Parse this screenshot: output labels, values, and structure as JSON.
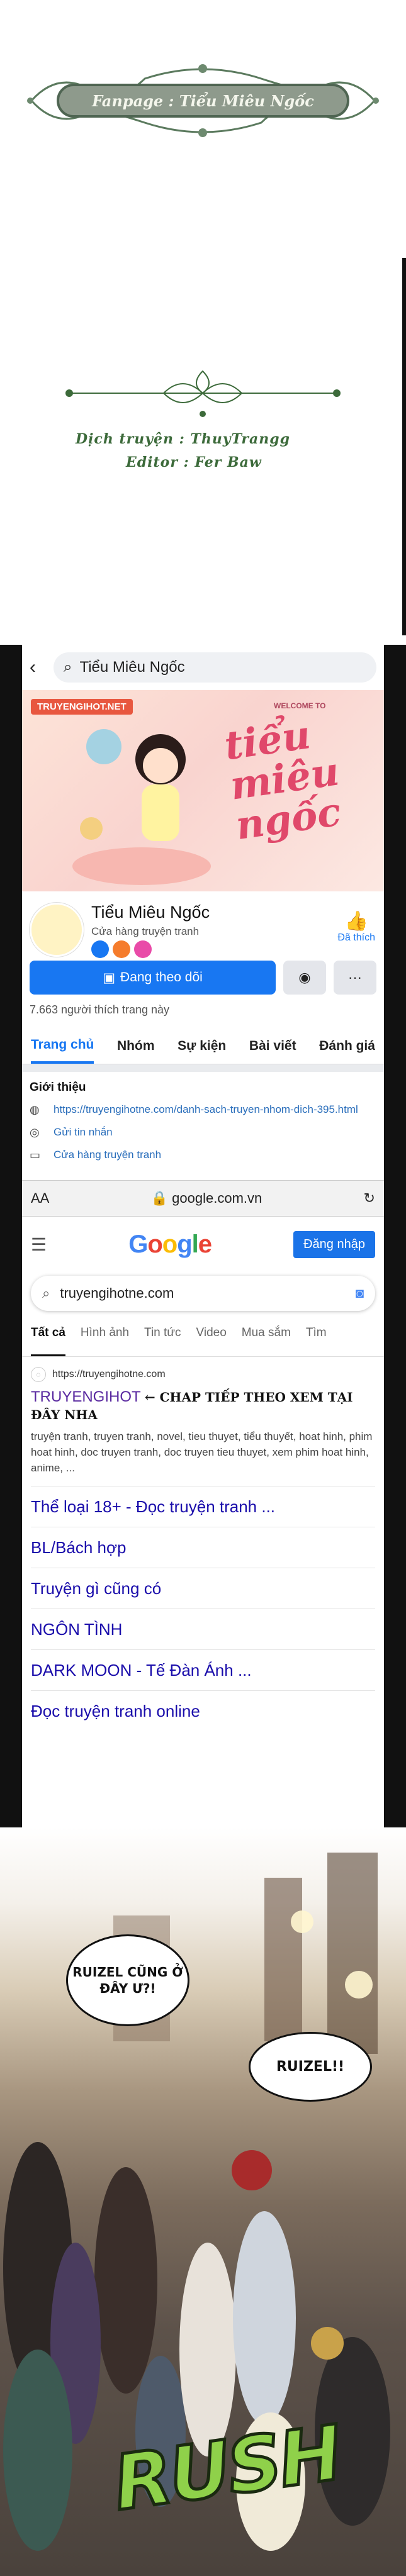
{
  "credits": {
    "fanpage": "Fanpage : Tiểu Miêu Ngốc",
    "translator": "Dịch truyện : ThuyTrangg",
    "editor": "Editor : Fer Baw"
  },
  "facebook": {
    "search_text": "Tiểu Miêu Ngốc",
    "cover_tag": "TRUYENGIHOT.NET",
    "cover_welcome": "WELCOME TO",
    "cover_script": "tiểu miêu ngốc",
    "page_name": "Tiểu Miêu Ngốc",
    "page_category": "Cửa hàng truyện tranh",
    "liked_label": "Đã thích",
    "follow_label": "Đang theo dõi",
    "more_label": "···",
    "likes_count": "7.663 người thích trang này",
    "tabs": [
      "Trang chủ",
      "Nhóm",
      "Sự kiện",
      "Bài viết",
      "Đánh giá"
    ],
    "intro_title": "Giới thiệu",
    "intro_link": "https://truyengihotne.com/danh-sach-truyen-nhom-dich-395.html",
    "intro_message": "Gửi tin nhắn",
    "intro_category": "Cửa hàng truyện tranh"
  },
  "safari": {
    "aa": "AA",
    "url": "google.com.vn",
    "reload": "↻"
  },
  "google": {
    "logo": "Google",
    "signin": "Đăng nhập",
    "query": "truyengihotne.com",
    "tabs": [
      "Tất cả",
      "Hình ảnh",
      "Tin tức",
      "Video",
      "Mua sắm",
      "Tìm"
    ],
    "result_url": "https://truyengihotne.com",
    "result_title": "TRUYENGIHOT",
    "result_title_note": "← CHAP TIẾP THEO XEM TẠI ĐÂY NHA",
    "result_desc": "truyện tranh, truyen tranh, novel, tieu thuyet, tiểu thuyết, hoat hinh, phim hoat hinh, doc truyen tranh, doc truyen tieu thuyet, xem phim hoat hinh, anime, ...",
    "sitelinks": [
      "Thể loại 18+ - Đọc truyện tranh ...",
      "BL/Bách hợp",
      "Truyện gì cũng có",
      "NGÔN TÌNH",
      "DARK MOON - Tế Đàn Ánh ...",
      "Đọc truyện tranh online"
    ]
  },
  "comic": {
    "bubble1": "RUIZEL CŨNG Ở ĐÂY Ư?!",
    "bubble2": "RUIZEL!!",
    "sfx": "RUSH"
  },
  "colors": {
    "fb_blue": "#1877f2",
    "credit_green": "#3c6a3a",
    "rush_green": "#8fd14a"
  }
}
